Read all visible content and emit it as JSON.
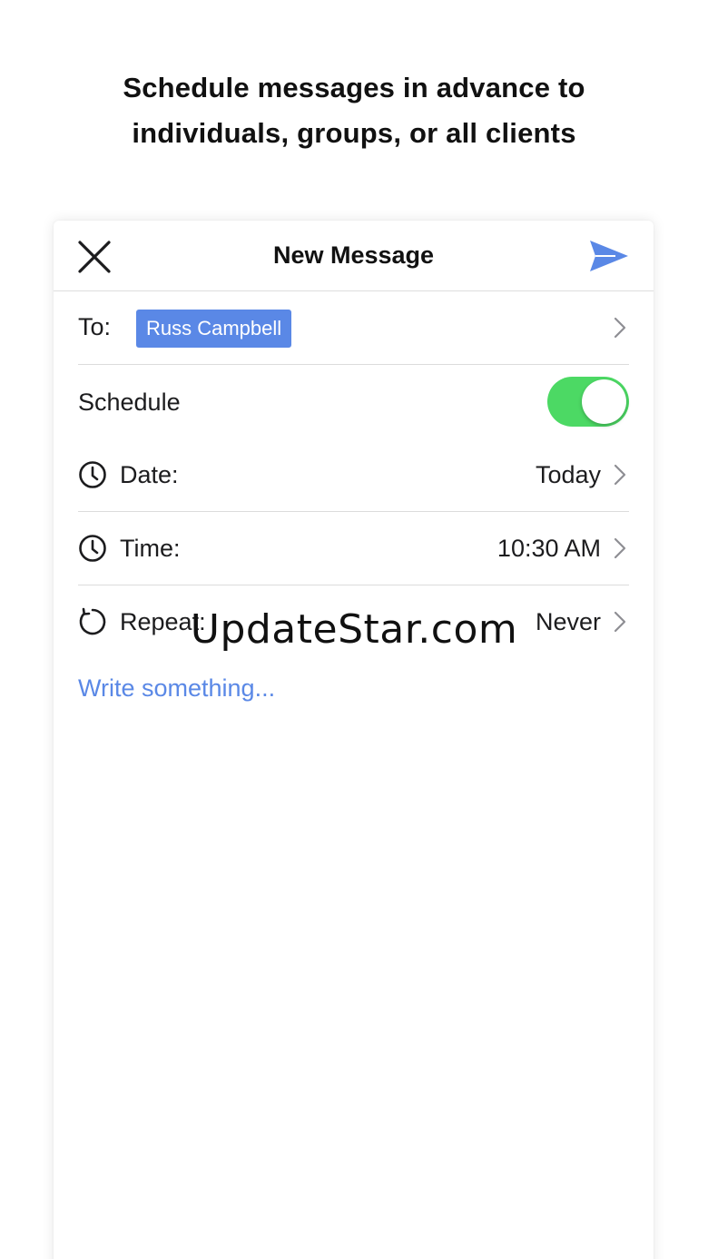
{
  "headline": {
    "line1": "Schedule messages in advance to",
    "line2": "individuals, groups, or all clients"
  },
  "navbar": {
    "title": "New Message",
    "close_icon": "close-icon",
    "send_icon": "send-icon"
  },
  "to_row": {
    "label": "To:",
    "recipient": "Russ Campbell"
  },
  "schedule_row": {
    "label": "Schedule",
    "enabled": true
  },
  "date_row": {
    "icon": "clock-icon",
    "label": "Date:",
    "value": "Today"
  },
  "time_row": {
    "icon": "clock-icon",
    "label": "Time:",
    "value": "10:30 AM"
  },
  "repeat_row": {
    "icon": "repeat-icon",
    "label": "Repeat:",
    "value": "Never"
  },
  "compose": {
    "placeholder": "Write something..."
  },
  "watermark": "UpdateStar.com",
  "colors": {
    "accent": "#5a88e6",
    "toggle_on": "#4cd964",
    "text": "#1c1c1e"
  }
}
